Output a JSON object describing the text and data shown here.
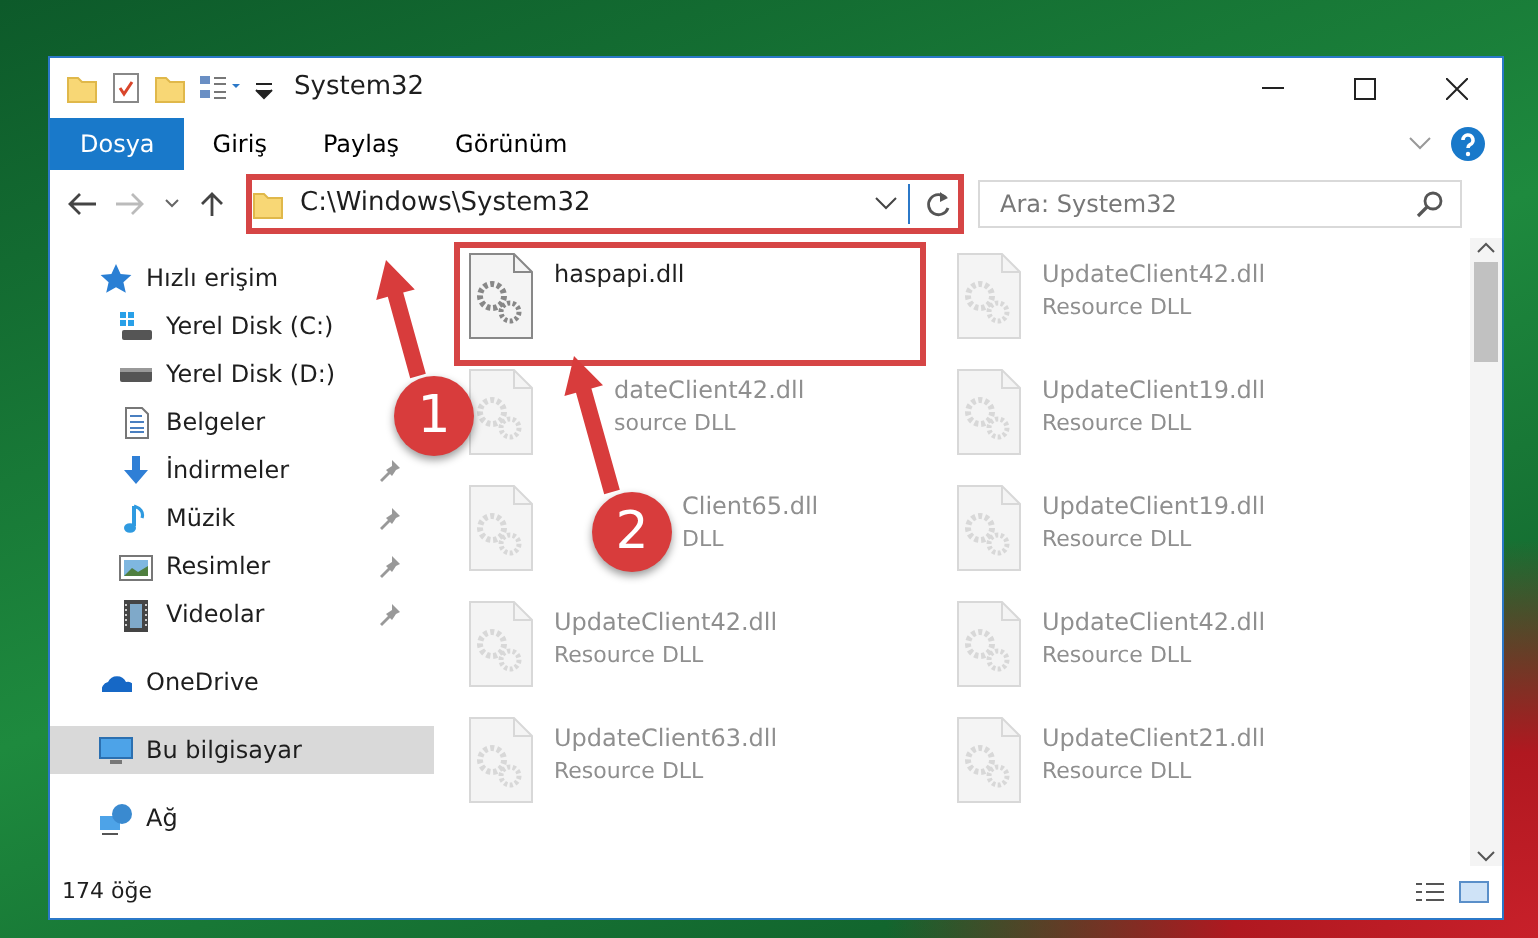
{
  "window": {
    "title": "System32"
  },
  "ribbon": {
    "tabs": [
      {
        "label": "Dosya",
        "selected": true
      },
      {
        "label": "Giriş",
        "selected": false
      },
      {
        "label": "Paylaş",
        "selected": false
      },
      {
        "label": "Görünüm",
        "selected": false
      }
    ]
  },
  "address_bar": {
    "path": "C:\\Windows\\System32",
    "highlighted": true
  },
  "search": {
    "placeholder": "Ara: System32"
  },
  "navigation": [
    {
      "label": "Hızlı erişim",
      "kind": "star",
      "selected": false,
      "children": [
        {
          "label": "Yerel Disk (C:)",
          "kind": "windows-drive",
          "selected": false,
          "pinned": false
        },
        {
          "label": "Yerel Disk (D:)",
          "kind": "drive",
          "selected": false,
          "pinned": false
        },
        {
          "label": "Belgeler",
          "kind": "document",
          "selected": false,
          "pinned": false
        },
        {
          "label": "İndirmeler",
          "kind": "download",
          "selected": false,
          "pinned": true
        },
        {
          "label": "Müzik",
          "kind": "music",
          "selected": false,
          "pinned": true
        },
        {
          "label": "Resimler",
          "kind": "picture",
          "selected": false,
          "pinned": true
        },
        {
          "label": "Videolar",
          "kind": "video",
          "selected": false,
          "pinned": true
        }
      ]
    },
    {
      "label": "OneDrive",
      "kind": "cloud",
      "selected": false
    },
    {
      "label": "Bu bilgisayar",
      "kind": "computer",
      "selected": true
    },
    {
      "label": "Ağ",
      "kind": "network",
      "selected": false
    }
  ],
  "files": [
    {
      "name": "haspapi.dll",
      "highlighted": true,
      "faded": false
    },
    {
      "name": "UpdateClient42.dll",
      "type": "Resource DLL",
      "highlighted": false,
      "faded": true
    },
    {
      "name": "dateClient42.dll",
      "type": "source DLL",
      "highlighted": false,
      "faded": true,
      "under_arrow": true
    },
    {
      "name": "UpdateClient19.dll",
      "type": "Resource DLL",
      "highlighted": false,
      "faded": true
    },
    {
      "name": "Client65.dll",
      "type": "DLL",
      "highlighted": false,
      "faded": true,
      "under_circle": true
    },
    {
      "name": "UpdateClient19.dll",
      "type": "Resource DLL",
      "highlighted": false,
      "faded": true
    },
    {
      "name": "UpdateClient42.dll",
      "type": "Resource DLL",
      "highlighted": false,
      "faded": true
    },
    {
      "name": "UpdateClient42.dll",
      "type": "Resource DLL",
      "highlighted": false,
      "faded": true
    },
    {
      "name": "UpdateClient63.dll",
      "type": "Resource DLL",
      "highlighted": false,
      "faded": true
    },
    {
      "name": "UpdateClient21.dll",
      "type": "Resource DLL",
      "highlighted": false,
      "faded": true
    }
  ],
  "status_bar": {
    "item_count": "174 öğe"
  },
  "annotations": [
    {
      "label": "1"
    },
    {
      "label": "2"
    }
  ]
}
